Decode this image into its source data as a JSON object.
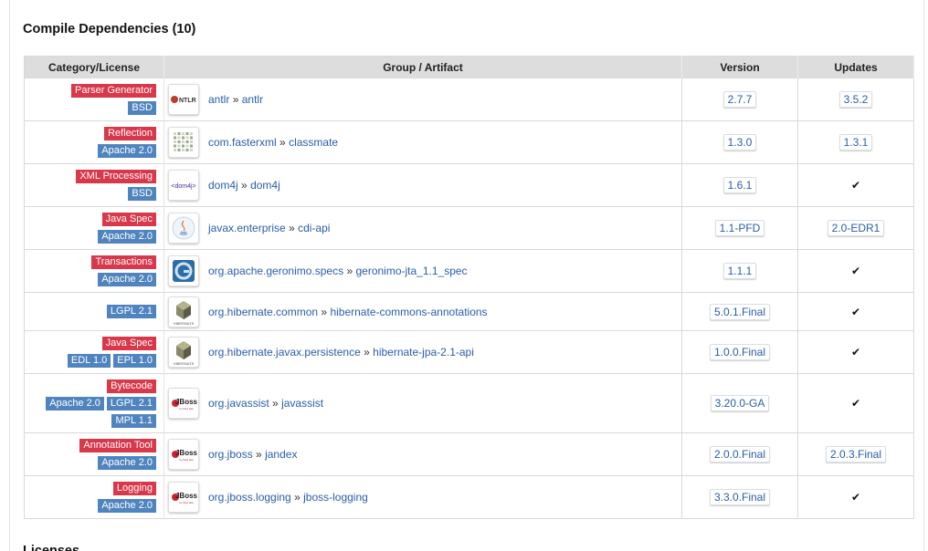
{
  "section_title": "Compile Dependencies (10)",
  "next_section_title": "Licenses",
  "columns": [
    "Category/License",
    "Group / Artifact",
    "Version",
    "Updates"
  ],
  "check_symbol": "✔",
  "separator": "»",
  "colors": {
    "category_badge": "#d9374a",
    "license_badge": "#4f84bf",
    "link": "#2a5da8"
  },
  "rows": [
    {
      "category": "Parser Generator",
      "licenses": [
        [
          "BSD"
        ]
      ],
      "logo": "antlr-logo",
      "group": "antlr",
      "artifact": "antlr",
      "version": "2.7.7",
      "update": "3.5.2"
    },
    {
      "category": "Reflection",
      "licenses": [
        [
          "Apache 2.0"
        ]
      ],
      "logo": "classmate-logo",
      "group": "com.fasterxml",
      "artifact": "classmate",
      "version": "1.3.0",
      "update": "1.3.1"
    },
    {
      "category": "XML Processing",
      "licenses": [
        [
          "BSD"
        ]
      ],
      "logo": "dom4j-logo",
      "group": "dom4j",
      "artifact": "dom4j",
      "version": "1.6.1",
      "update": ""
    },
    {
      "category": "Java Spec",
      "licenses": [
        [
          "Apache 2.0"
        ]
      ],
      "logo": "java-logo",
      "group": "javax.enterprise",
      "artifact": "cdi-api",
      "version": "1.1-PFD",
      "update": "2.0-EDR1"
    },
    {
      "category": "Transactions",
      "licenses": [
        [
          "Apache 2.0"
        ]
      ],
      "logo": "geronimo-logo",
      "group": "org.apache.geronimo.specs",
      "artifact": "geronimo-jta_1.1_spec",
      "version": "1.1.1",
      "update": ""
    },
    {
      "category": "",
      "licenses": [
        [
          "LGPL 2.1"
        ]
      ],
      "logo": "hibernate-logo",
      "group": "org.hibernate.common",
      "artifact": "hibernate-commons-annotations",
      "version": "5.0.1.Final",
      "update": ""
    },
    {
      "category": "Java Spec",
      "licenses": [
        [
          "EDL 1.0",
          "EPL 1.0"
        ]
      ],
      "logo": "hibernate-logo",
      "group": "org.hibernate.javax.persistence",
      "artifact": "hibernate-jpa-2.1-api",
      "version": "1.0.0.Final",
      "update": ""
    },
    {
      "category": "Bytecode",
      "licenses": [
        [
          "Apache 2.0",
          "LGPL 2.1"
        ],
        [
          "MPL 1.1"
        ]
      ],
      "logo": "jboss-logo",
      "group": "org.javassist",
      "artifact": "javassist",
      "version": "3.20.0-GA",
      "update": ""
    },
    {
      "category": "Annotation Tool",
      "licenses": [
        [
          "Apache 2.0"
        ]
      ],
      "logo": "jboss-logo",
      "group": "org.jboss",
      "artifact": "jandex",
      "version": "2.0.0.Final",
      "update": "2.0.3.Final"
    },
    {
      "category": "Logging",
      "licenses": [
        [
          "Apache 2.0"
        ]
      ],
      "logo": "jboss-logo",
      "group": "org.jboss.logging",
      "artifact": "jboss-logging",
      "version": "3.3.0.Final",
      "update": ""
    }
  ],
  "logo_text": {
    "antlr": "ANTLR",
    "dom4j": "<dom4j>",
    "hibernate": "HIBERNATE",
    "jboss": "JBoss",
    "jboss_sub": "by Red Hat"
  }
}
